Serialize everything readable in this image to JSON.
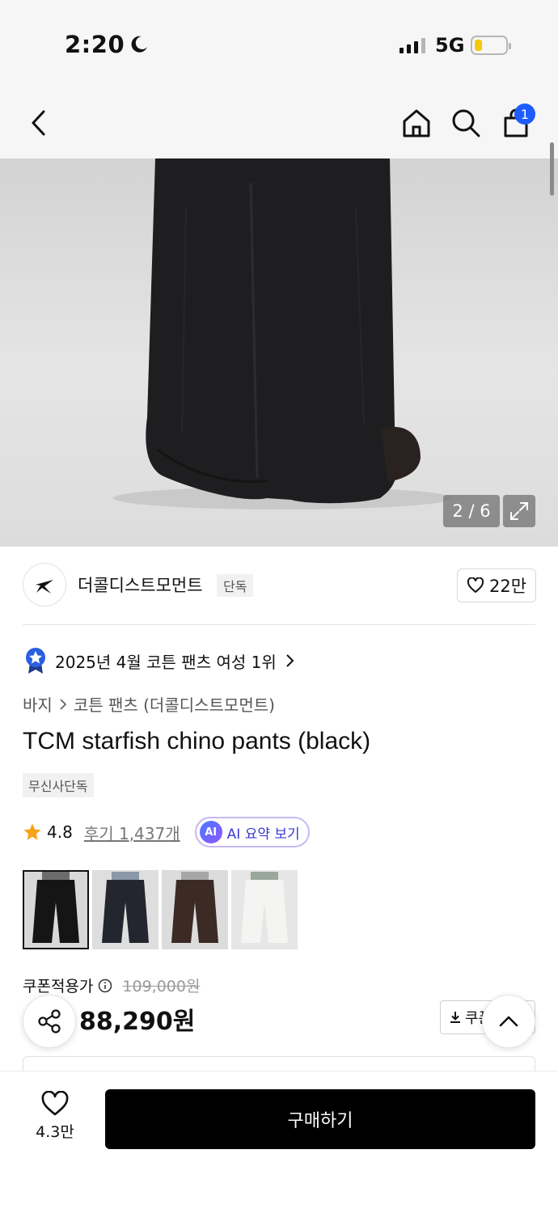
{
  "status_bar": {
    "time": "2:20",
    "network": "5G"
  },
  "nav": {
    "cart_count": "1"
  },
  "gallery": {
    "counter": "2 / 6"
  },
  "brand": {
    "name": "더콜디스트모먼트",
    "tag": "단독",
    "likes": "22만"
  },
  "ranking": {
    "text": "2025년 4월 코튼 팬츠 여성 1위"
  },
  "breadcrumb": {
    "category": "바지",
    "subcategory": "코튼 팬츠 (더콜디스트모먼트)"
  },
  "product": {
    "title": "TCM starfish chino pants (black)",
    "exclusive_tag": "무신사단독",
    "rating": "4.8",
    "reviews": "후기 1,437개",
    "ai_summary": "AI 요약 보기",
    "ai_badge": "AI"
  },
  "thumbnails": [
    {
      "color": "black"
    },
    {
      "color": "navy"
    },
    {
      "color": "brown"
    },
    {
      "color": "white"
    }
  ],
  "price": {
    "label": "쿠폰적용가",
    "original": "109,000원",
    "final": "88,290원",
    "coupon_button": "쿠폰"
  },
  "bottom_bar": {
    "likes": "4.3만",
    "buy_label": "구매하기"
  },
  "colors": {
    "accent_blue": "#1f5cff",
    "discount_red": "#ff3b2f",
    "buy_black": "#000000"
  }
}
